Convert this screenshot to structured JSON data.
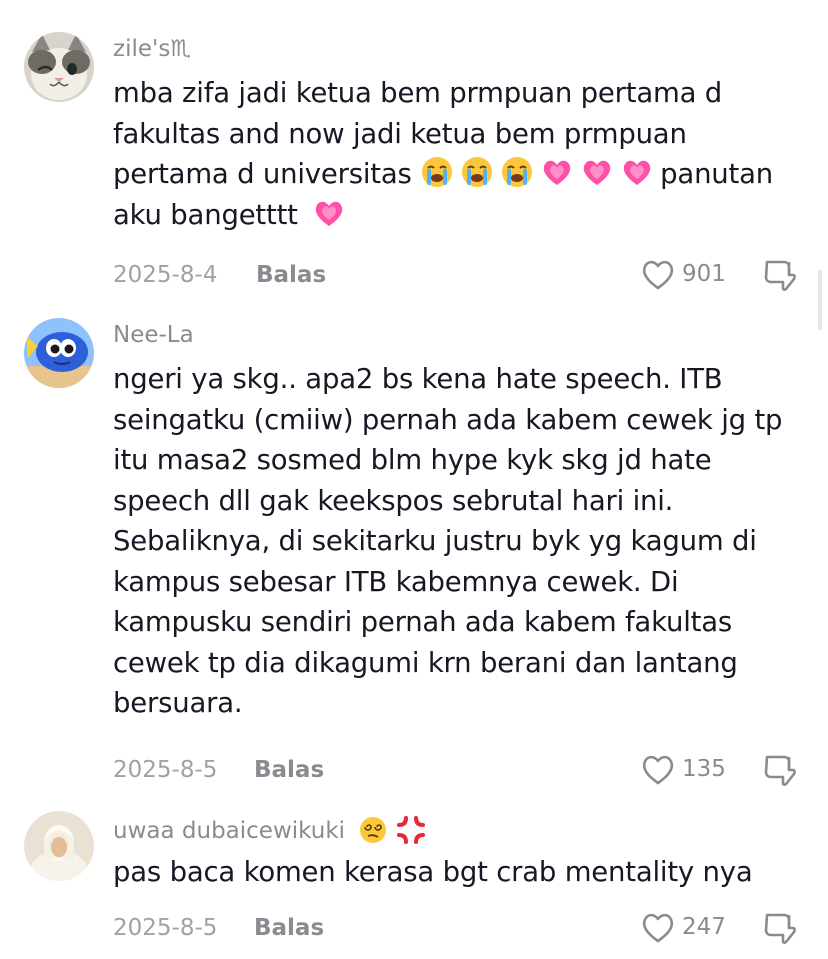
{
  "comments": [
    {
      "username": "zile's♏",
      "text_before_emoji": "mba zifa jadi ketua bem prmpuan pertama d fakultas and now jadi ketua bem prmpuan pertama d universitas",
      "text_after_emoji": "panutan aku bangetttt",
      "date": "2025-8-4",
      "reply_label": "Balas",
      "likes": "901",
      "emojis": [
        "loudly-crying-face",
        "loudly-crying-face",
        "loudly-crying-face",
        "growing-heart",
        "growing-heart",
        "growing-heart"
      ],
      "trailing_emoji": "growing-heart"
    },
    {
      "username": "Nee-La",
      "text": "ngeri ya skg.. apa2 bs kena hate speech. ITB seingatku (cmiiw) pernah ada kabem cewek jg tp itu masa2 sosmed blm hype kyk skg jd hate speech dll gak keekspos sebrutal hari ini. Sebaliknya, di sekitarku justru byk yg kagum di kampus sebesar ITB kabemnya cewek. Di kampusku sendiri pernah ada kabem fakultas cewek tp dia dikagumi krn berani dan lantang bersuara.",
      "date": "2025-8-5",
      "reply_label": "Balas",
      "likes": "135"
    },
    {
      "username": "uwaa dubaicewikuki",
      "username_emojis": [
        "face-with-spiral-eyes",
        "anger-symbol"
      ],
      "text": "pas baca komen kerasa bgt crab mentality nya",
      "date": "2025-8-5",
      "reply_label": "Balas",
      "likes": "247"
    }
  ],
  "icons": {
    "like": "heart-outline-icon",
    "dislike": "thumbs-down-icon"
  },
  "colors": {
    "text": "#161823",
    "muted": "#8a8b91",
    "date": "#a0a1a7",
    "heart": "#ff4fa7"
  }
}
